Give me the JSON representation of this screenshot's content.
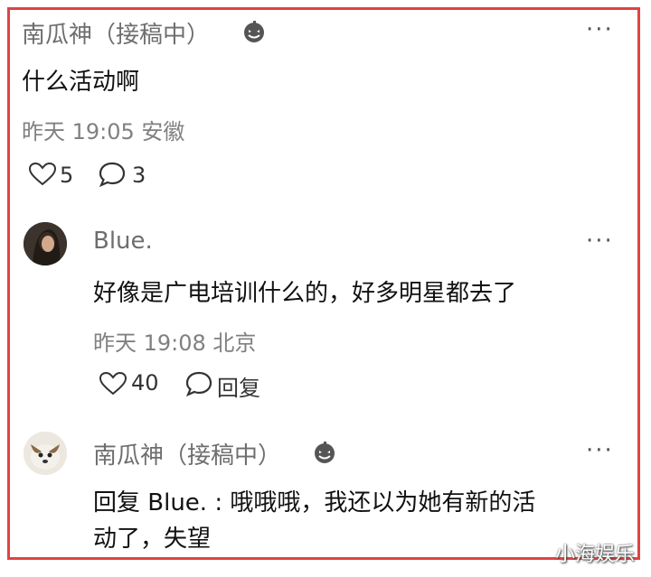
{
  "comment1": {
    "user": "南瓜神（接稿中）",
    "badge_icon": "pumpkin-icon",
    "text": "什么活动啊",
    "time": "昨天 19:05 安徽",
    "likes": "5",
    "replies": "3",
    "more": "···"
  },
  "reply1": {
    "user": "Blue.",
    "text": "好像是广电培训什么的，好多明星都去了",
    "time": "昨天 19:08 北京",
    "likes": "40",
    "reply_label": "回复",
    "more": "···"
  },
  "reply2": {
    "user": "南瓜神（接稿中）",
    "badge_icon": "pumpkin-icon",
    "text_line1": "回复 Blue. : 哦哦哦，我还以为她有新的活",
    "text_line2": "动了，失望",
    "more": "···"
  },
  "watermark": "小海娱乐",
  "colors": {
    "frame": "#e04343",
    "meta": "#808080",
    "name": "#6e6e6e"
  }
}
